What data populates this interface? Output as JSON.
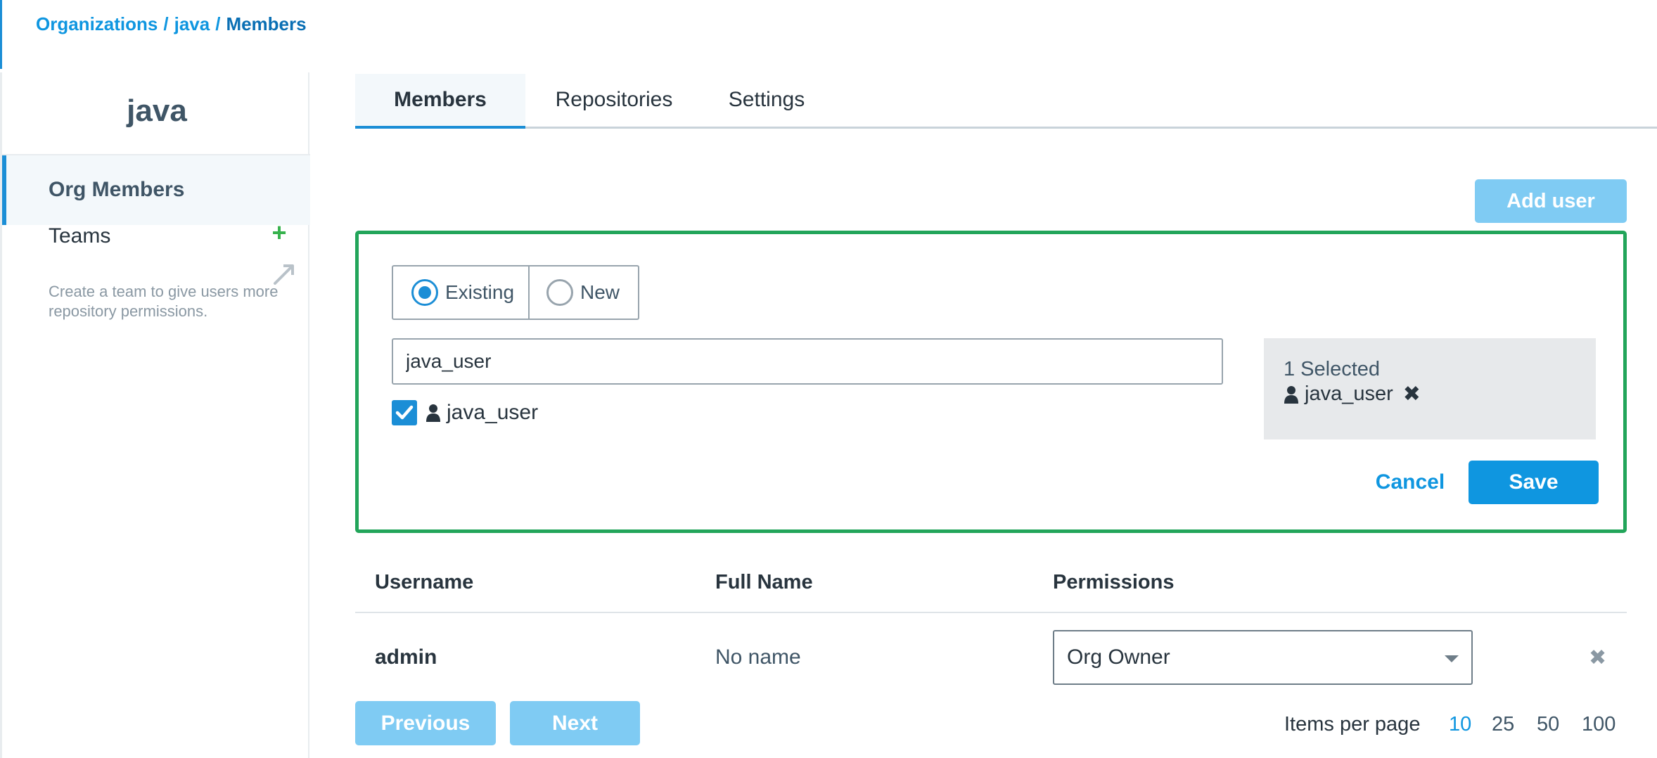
{
  "breadcrumb": {
    "root": "Organizations",
    "org": "java",
    "current": "Members",
    "separator": "/"
  },
  "sidebar": {
    "org_name": "java",
    "items": [
      {
        "label": "Org Members",
        "active": true
      },
      {
        "label": "Teams"
      }
    ],
    "teams_hint": "Create a team to give users more repository permissions."
  },
  "tabs": [
    {
      "label": "Members",
      "active": true
    },
    {
      "label": "Repositories"
    },
    {
      "label": "Settings"
    }
  ],
  "add_user_label": "Add user",
  "add_panel": {
    "mode_options": [
      {
        "label": "Existing",
        "checked": true
      },
      {
        "label": "New",
        "checked": false
      }
    ],
    "search": {
      "value": "java_user"
    },
    "results": [
      {
        "username": "java_user",
        "checked": true
      }
    ],
    "selected": {
      "count_label": "1 Selected",
      "items": [
        "java_user"
      ]
    },
    "cancel_label": "Cancel",
    "save_label": "Save"
  },
  "table": {
    "columns": [
      "Username",
      "Full Name",
      "Permissions"
    ],
    "rows": [
      {
        "username": "admin",
        "full_name": "No name",
        "permission": "Org Owner"
      }
    ]
  },
  "pagination": {
    "previous_label": "Previous",
    "next_label": "Next",
    "items_per_page_label": "Items per page",
    "options": [
      "10",
      "25",
      "50",
      "100"
    ],
    "selected": "10"
  },
  "colors": {
    "accent": "#0f96e0",
    "panel_border": "#22a55a",
    "disabled_button": "#7fcbf3",
    "plus_icon": "#37b24d"
  }
}
